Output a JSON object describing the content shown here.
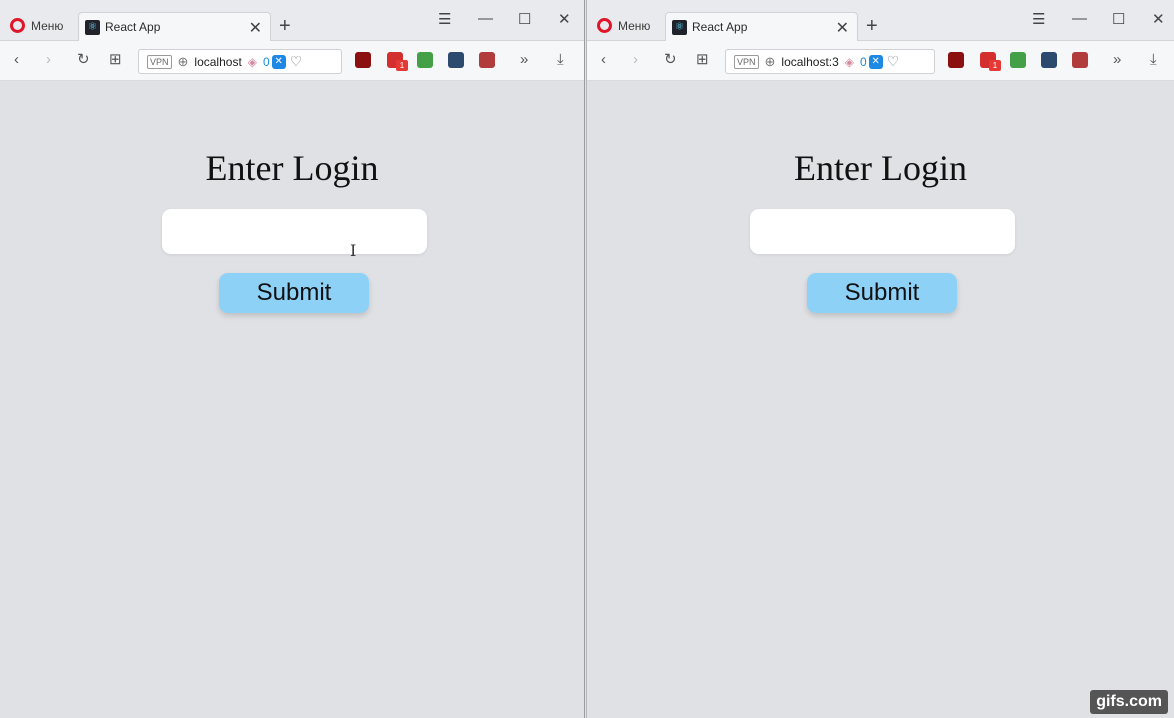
{
  "left_window": {
    "menu_label": "Меню",
    "tab_title": "React App",
    "vpn_label": "VPN",
    "url": "localhost",
    "tracker_count": "0",
    "badge_count": "1",
    "page": {
      "heading": "Enter Login",
      "input_value": "",
      "submit_label": "Submit"
    }
  },
  "right_window": {
    "menu_label": "Меню",
    "tab_title": "React App",
    "vpn_label": "VPN",
    "url": "localhost:3",
    "tracker_count": "0",
    "badge_count": "1",
    "page": {
      "heading": "Enter Login",
      "input_value": "",
      "submit_label": "Submit"
    }
  },
  "icons": {
    "back": "chevron-left-icon",
    "forward": "chevron-right-icon",
    "reload": "reload-icon",
    "speed_dial": "grid-icon",
    "download": "download-icon"
  },
  "colors": {
    "page_background": "#dfe1e5",
    "button_background": "#8ed1f7",
    "opera_red": "#e2162a"
  },
  "watermark": "gifs.com"
}
